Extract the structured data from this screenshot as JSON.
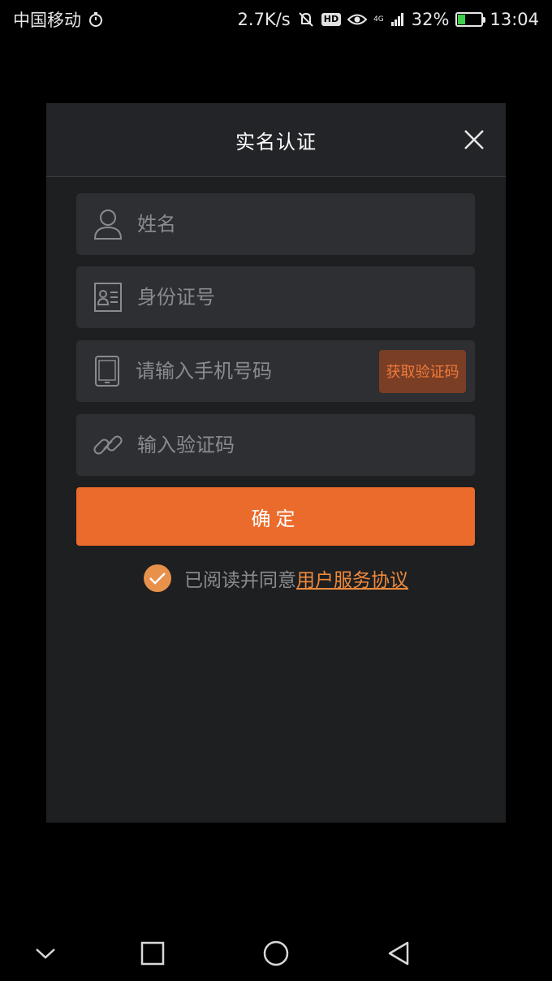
{
  "status_bar": {
    "carrier": "中国移动",
    "net_speed": "2.7K/s",
    "hd": "HD",
    "network_type": "4G",
    "battery_percent": "32%",
    "battery_level": 0.32,
    "time": "13:04"
  },
  "dialog": {
    "title": "实名认证",
    "fields": {
      "name": {
        "placeholder": "姓名",
        "value": ""
      },
      "id_number": {
        "placeholder": "身份证号",
        "value": ""
      },
      "phone": {
        "placeholder": "请输入手机号码",
        "value": ""
      },
      "code": {
        "placeholder": "输入验证码",
        "value": ""
      }
    },
    "get_code_label": "获取验证码",
    "confirm_label": "确定",
    "agreement": {
      "checked": true,
      "prefix": "已阅读并同意",
      "link": "用户服务协议"
    }
  },
  "colors": {
    "accent": "#ea6b2b",
    "check": "#e8914a",
    "link": "#ef8a3c",
    "dialog_bg": "#1e1f21",
    "field_bg": "#2e2f32"
  }
}
